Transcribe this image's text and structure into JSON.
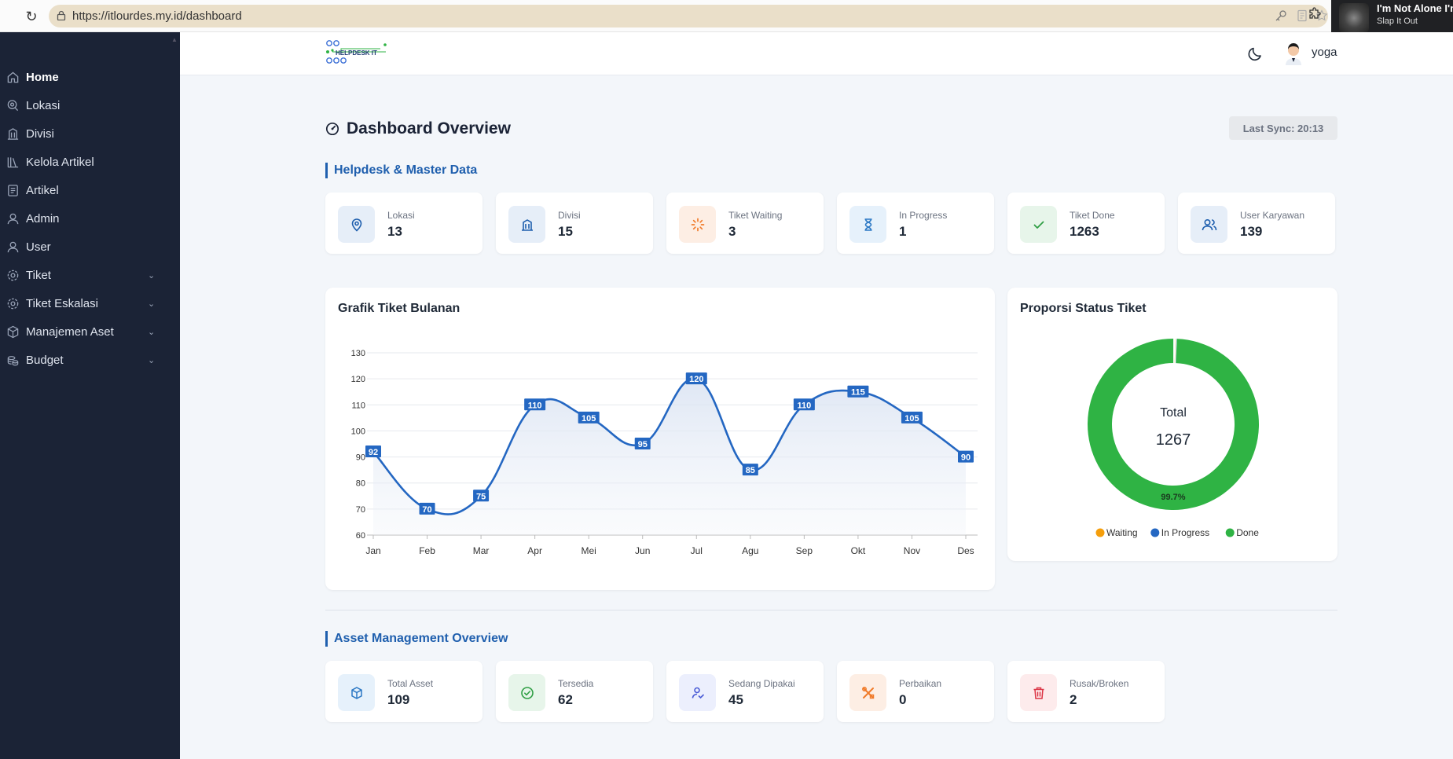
{
  "browser": {
    "url_prefix": "https://",
    "url_host": "itlourdes.my.id",
    "url_path": "/dashboard",
    "media": {
      "title": "I'm Not Alone I'm",
      "subtitle": "Slap It Out"
    }
  },
  "sidebar": {
    "items": [
      {
        "label": "Home",
        "icon": "home-icon",
        "active": true
      },
      {
        "label": "Lokasi",
        "icon": "location-icon"
      },
      {
        "label": "Divisi",
        "icon": "building-icon"
      },
      {
        "label": "Kelola Artikel",
        "icon": "library-icon"
      },
      {
        "label": "Artikel",
        "icon": "article-icon"
      },
      {
        "label": "Admin",
        "icon": "user-icon"
      },
      {
        "label": "User",
        "icon": "user-icon"
      },
      {
        "label": "Tiket",
        "icon": "gear-icon",
        "expandable": true
      },
      {
        "label": "Tiket Eskalasi",
        "icon": "gear-icon",
        "expandable": true
      },
      {
        "label": "Manajemen Aset",
        "icon": "box-icon",
        "expandable": true
      },
      {
        "label": "Budget",
        "icon": "coins-icon",
        "expandable": true
      }
    ]
  },
  "header": {
    "logo_text": "HELPDESK IT",
    "username": "yoga"
  },
  "page": {
    "title": "Dashboard Overview",
    "last_sync": "Last Sync: 20:13"
  },
  "helpdesk": {
    "heading": "Helpdesk & Master Data",
    "cards": [
      {
        "label": "Lokasi",
        "value": "13",
        "icon": "location-pin-icon",
        "color": "#1f5fae",
        "bg": "#e6eef8"
      },
      {
        "label": "Divisi",
        "value": "15",
        "icon": "building-icon",
        "color": "#1f5fae",
        "bg": "#e6eef8"
      },
      {
        "label": "Tiket Waiting",
        "value": "3",
        "icon": "loader-icon",
        "color": "#f07b2a",
        "bg": "#fdeee4"
      },
      {
        "label": "In Progress",
        "value": "1",
        "icon": "hourglass-icon",
        "color": "#2b78c4",
        "bg": "#e6f1fb"
      },
      {
        "label": "Tiket Done",
        "value": "1263",
        "icon": "check-icon",
        "color": "#2f9e44",
        "bg": "#e7f5ea"
      },
      {
        "label": "User Karyawan",
        "value": "139",
        "icon": "users-icon",
        "color": "#1f5fae",
        "bg": "#e6eef8"
      }
    ]
  },
  "chart_data": [
    {
      "type": "line",
      "title": "Grafik Tiket Bulanan",
      "categories": [
        "Jan",
        "Feb",
        "Mar",
        "Apr",
        "Mei",
        "Jun",
        "Jul",
        "Agu",
        "Sep",
        "Okt",
        "Nov",
        "Des"
      ],
      "values": [
        92,
        70,
        75,
        110,
        105,
        95,
        120,
        85,
        110,
        115,
        105,
        90
      ],
      "ylim": [
        60,
        130
      ],
      "yticks": [
        60,
        70,
        80,
        90,
        100,
        110,
        120,
        130
      ],
      "grid": true,
      "color": "#2467c2"
    },
    {
      "type": "pie",
      "title": "Proporsi Status Tiket",
      "center_label": "Total",
      "center_value": "1267",
      "slices": [
        {
          "name": "Waiting",
          "value": 3,
          "color": "#f59e0b"
        },
        {
          "name": "In Progress",
          "value": 1,
          "color": "#2467c2"
        },
        {
          "name": "Done",
          "value": 1263,
          "color": "#2fb344"
        }
      ],
      "done_label": "99.7%",
      "legend": "bottom"
    }
  ],
  "assets": {
    "heading": "Asset Management Overview",
    "cards": [
      {
        "label": "Total Asset",
        "value": "109",
        "icon": "cube-icon",
        "color": "#2b78c4",
        "bg": "#e6f1fb"
      },
      {
        "label": "Tersedia",
        "value": "62",
        "icon": "check-circle-icon",
        "color": "#2f9e44",
        "bg": "#e7f5ea"
      },
      {
        "label": "Sedang Dipakai",
        "value": "45",
        "icon": "user-check-icon",
        "color": "#4a5bd6",
        "bg": "#eceffd"
      },
      {
        "label": "Perbaikan",
        "value": "0",
        "icon": "tools-icon",
        "color": "#f07b2a",
        "bg": "#fdeee4"
      },
      {
        "label": "Rusak/Broken",
        "value": "2",
        "icon": "trash-icon",
        "color": "#dc3545",
        "bg": "#fdebec"
      }
    ]
  }
}
